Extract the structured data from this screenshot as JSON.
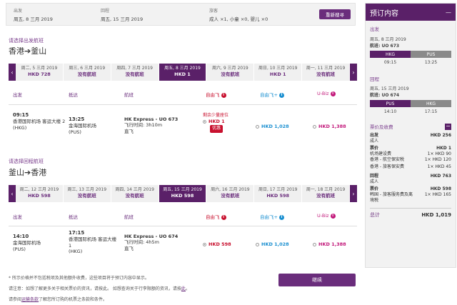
{
  "top": {
    "depart_label": "出发",
    "depart_value": "周五, 8 三月 2019",
    "return_label": "回程",
    "return_value": "周五, 15 三月 2019",
    "pax_label": "旅客",
    "pax_value": "成人 ×1, 小童 ×0, 婴儿 ×0",
    "search_button": "重新搜寻"
  },
  "outbound": {
    "prompt": "请选择出发航班",
    "from": "香港",
    "arrow": "➔",
    "to": "釜山",
    "dates": [
      {
        "date": "周二, 5 三月 2019",
        "price": "HKD 728",
        "selected": false
      },
      {
        "date": "周三, 6 三月 2019",
        "price": "没有航班",
        "selected": false
      },
      {
        "date": "周四, 7 三月 2019",
        "price": "没有航班",
        "selected": false
      },
      {
        "date": "周五, 8 三月 2019",
        "price": "HKD 1",
        "selected": true
      },
      {
        "date": "周六, 9 三月 2019",
        "price": "没有航班",
        "selected": false
      },
      {
        "date": "周日, 10 三月 2019",
        "price": "HKD 1",
        "selected": false
      },
      {
        "date": "周一, 11 三月 2019",
        "price": "没有航班",
        "selected": false
      }
    ],
    "flight": {
      "dep_time": "09:15",
      "dep_place": "香港国际机场 客运大楼 2",
      "dep_code": "(HKG)",
      "arr_time": "13:25",
      "arr_place": "金海国际机场",
      "arr_code": "(PUS)",
      "flight_no": "HK Express - UO 673",
      "duration": "飞行时间: 3h10m",
      "stops": "直飞",
      "seats_left": "剩余少量座位",
      "fare1": "HKD 1",
      "promo": "优惠",
      "fare2": "HKD 1,028",
      "fare3": "HKD 1,388"
    }
  },
  "inbound": {
    "prompt": "请选择回程航班",
    "from": "釜山",
    "arrow": "➔",
    "to": "香港",
    "dates": [
      {
        "date": "周二, 12 三月 2019",
        "price": "HKD 598",
        "selected": false
      },
      {
        "date": "周三, 13 三月 2019",
        "price": "没有航班",
        "selected": false
      },
      {
        "date": "周四, 14 三月 2019",
        "price": "没有航班",
        "selected": false
      },
      {
        "date": "周五, 15 三月 2019",
        "price": "HKD 598",
        "selected": true
      },
      {
        "date": "周六, 16 三月 2019",
        "price": "没有航班",
        "selected": false
      },
      {
        "date": "周日, 17 三月 2019",
        "price": "HKD 598",
        "selected": false
      },
      {
        "date": "周一, 18 三月 2019",
        "price": "没有航班",
        "selected": false
      }
    ],
    "flight": {
      "dep_time": "14:10",
      "dep_place": "金海国际机场",
      "dep_code": "(PUS)",
      "arr_time": "17:15",
      "arr_place": "香港国际机场 客运大楼 1",
      "arr_code": "(HKG)",
      "flight_no": "HK Express - UO 674",
      "duration": "飞行时间: 4h5m",
      "stops": "直飞",
      "fare1": "HKD 598",
      "fare2": "HKD 1,028",
      "fare3": "HKD 1,388"
    }
  },
  "columns": {
    "depart": "出发",
    "arrive": "抵达",
    "flight": "航班",
    "fare1": "自由飞",
    "fare2": "自由飞+",
    "fare3": "U-Biz",
    "fare1_color": "#c8102e",
    "fare2_color": "#1a8fd0",
    "fare3_color": "#c2187a"
  },
  "sidebar": {
    "title": "预订内容",
    "out_label": "出发",
    "out_date": "周五, 8 三月 2019",
    "out_flight": "航班: UO 673",
    "out_from": "HKG",
    "out_to": "PUS",
    "out_dep": "09:15",
    "out_arr": "13:25",
    "ret_label": "回程",
    "ret_date": "周五, 15 三月 2019",
    "ret_flight": "航班: UO 674",
    "ret_from": "PUS",
    "ret_to": "HKG",
    "ret_dep": "14:10",
    "ret_arr": "17:15",
    "fees_label": "票价及收费",
    "out_total_label": "出发",
    "out_total": "HKD 256",
    "adult": "成人",
    "fare_label": "票价",
    "fare_val": "HKD 1",
    "fee1": "机场建设费",
    "fee1_val": "1× HKD 90",
    "fee2": "香港 - 航空保安税",
    "fee2_val": "1× HKD 120",
    "fee3": "香港 - 旅客保安费",
    "fee3_val": "1× HKD 45",
    "ret_total_label": "回程",
    "ret_total": "HKD 763",
    "adult2": "成人",
    "fare2_label": "票价",
    "fare2_val": "HKD 598",
    "fee4": "韩国 - 旅客服务费及离境税",
    "fee4_val": "1× HKD 165",
    "grand_label": "总计",
    "grand_total": "HKD 1,019"
  },
  "footer": {
    "continue": "继续",
    "note1": "* 所示价格并不包括税项及其他额外收费，这些项目将于预订内容中显示。",
    "note2a": "请注意：如想了解更多关于相关票价的资讯，请按此。 如想查询关于行李限额的资讯，请按",
    "note2_link": "此",
    "note3a": "请参阅",
    "note3_link": "运输条款",
    "note3b": "了解您所订购的机票之条款和条件。"
  }
}
